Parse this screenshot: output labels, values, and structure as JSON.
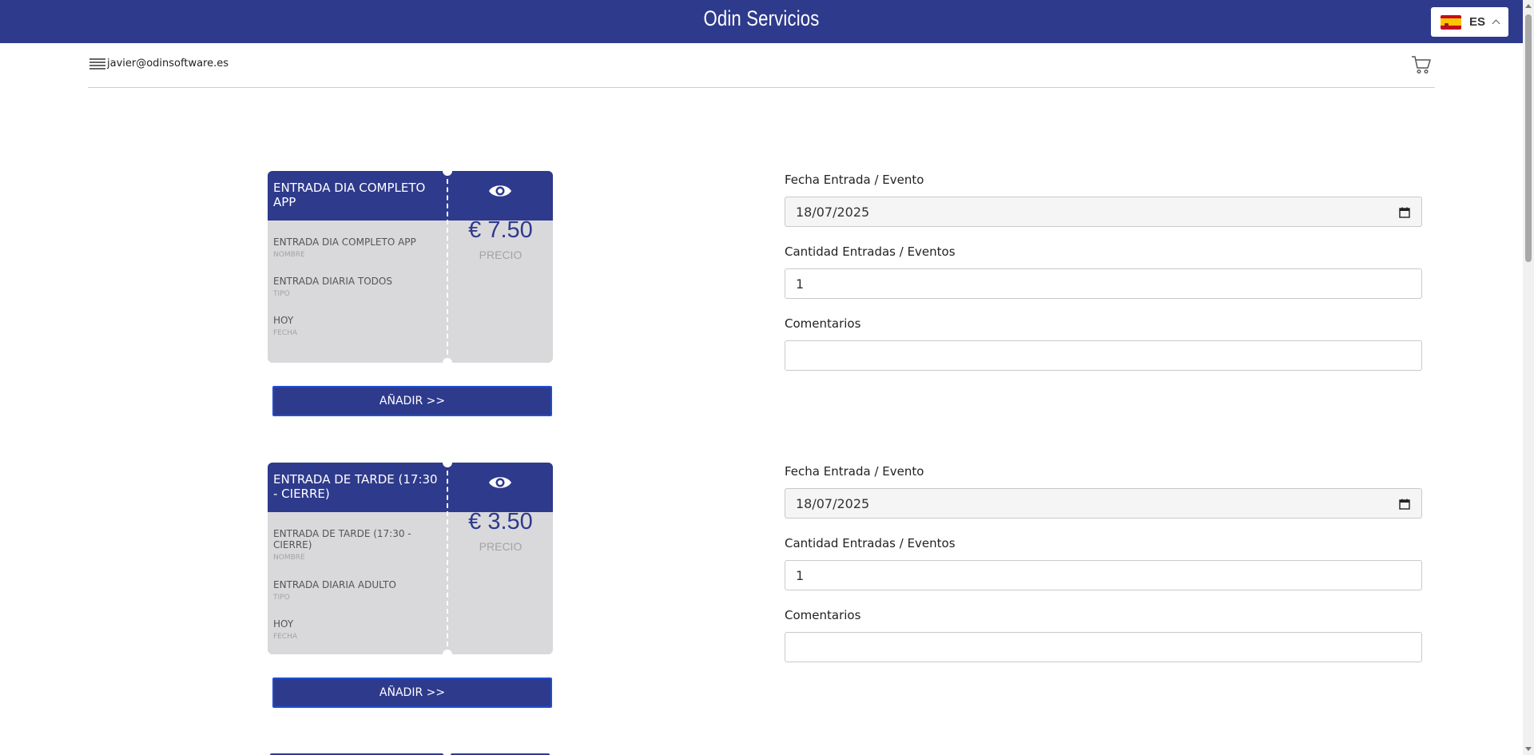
{
  "header": {
    "title": "Odin Servicios",
    "language": {
      "code": "ES",
      "icon": "spain-flag-icon"
    }
  },
  "subbar": {
    "user_email": "javier@odinsoftware.es",
    "menu_icon": "hamburger-menu-icon",
    "cart_icon": "shopping-cart-icon"
  },
  "tickets": [
    {
      "title": "ENTRADA DIA COMPLETO APP",
      "nombre": "ENTRADA DIA COMPLETO APP",
      "nombre_label": "NOMBRE",
      "tipo": "ENTRADA DIARIA TODOS",
      "tipo_label": "TIPO",
      "fecha": "HOY",
      "fecha_label": "FECHA",
      "price": "€ 7.50",
      "price_label": "PRECIO",
      "add_label": "AÑADIR >>",
      "form": {
        "fecha_label": "Fecha Entrada / Evento",
        "fecha_value": "18/07/2025",
        "cantidad_label": "Cantidad Entradas / Eventos",
        "cantidad_value": "1",
        "comentarios_label": "Comentarios",
        "comentarios_value": ""
      }
    },
    {
      "title": "ENTRADA DE TARDE (17:30 - CIERRE)",
      "nombre": "ENTRADA DE TARDE (17:30 - CIERRE)",
      "nombre_label": "NOMBRE",
      "tipo": "ENTRADA DIARIA ADULTO",
      "tipo_label": "TIPO",
      "fecha": "HOY",
      "fecha_label": "FECHA",
      "price": "€ 3.50",
      "price_label": "PRECIO",
      "add_label": "AÑADIR >>",
      "form": {
        "fecha_label": "Fecha Entrada / Evento",
        "fecha_value": "18/07/2025",
        "cantidad_label": "Cantidad Entradas / Eventos",
        "cantidad_value": "1",
        "comentarios_label": "Comentarios",
        "comentarios_value": ""
      }
    }
  ],
  "colors": {
    "primary": "#2e3a8c",
    "ticket_body": "#d9d9db",
    "muted": "#a3a3a6"
  }
}
